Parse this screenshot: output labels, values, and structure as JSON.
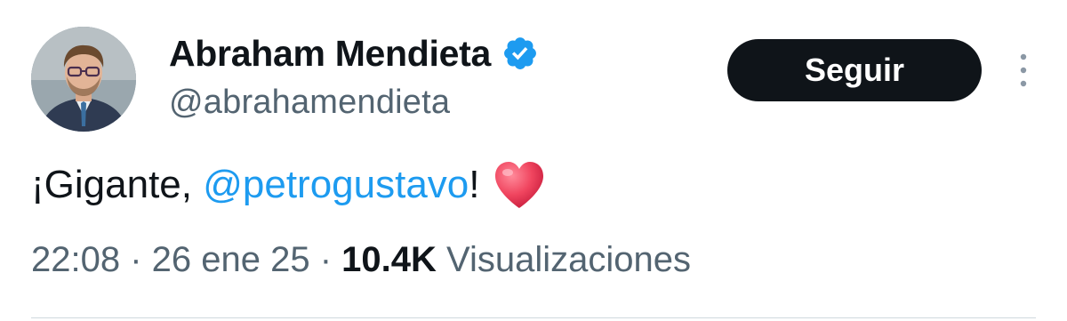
{
  "author": {
    "display_name": "Abraham Mendieta",
    "handle": "@abrahamendieta",
    "verified_color": "#1d9bf0"
  },
  "follow_button": {
    "label": "Seguir"
  },
  "tweet": {
    "text_before": "¡Gigante, ",
    "mention": "@petrogustavo",
    "text_after": "!",
    "emoji": "red-heart"
  },
  "meta": {
    "time": "22:08",
    "separator_1": " · ",
    "date": "26 ene 25",
    "separator_2": " · ",
    "views_count": "10.4K",
    "views_label": " Visualizaciones"
  },
  "colors": {
    "text_primary": "#0f1419",
    "text_secondary": "#536471",
    "link": "#1d9bf0",
    "button_bg": "#0f1419",
    "button_text": "#ffffff"
  }
}
